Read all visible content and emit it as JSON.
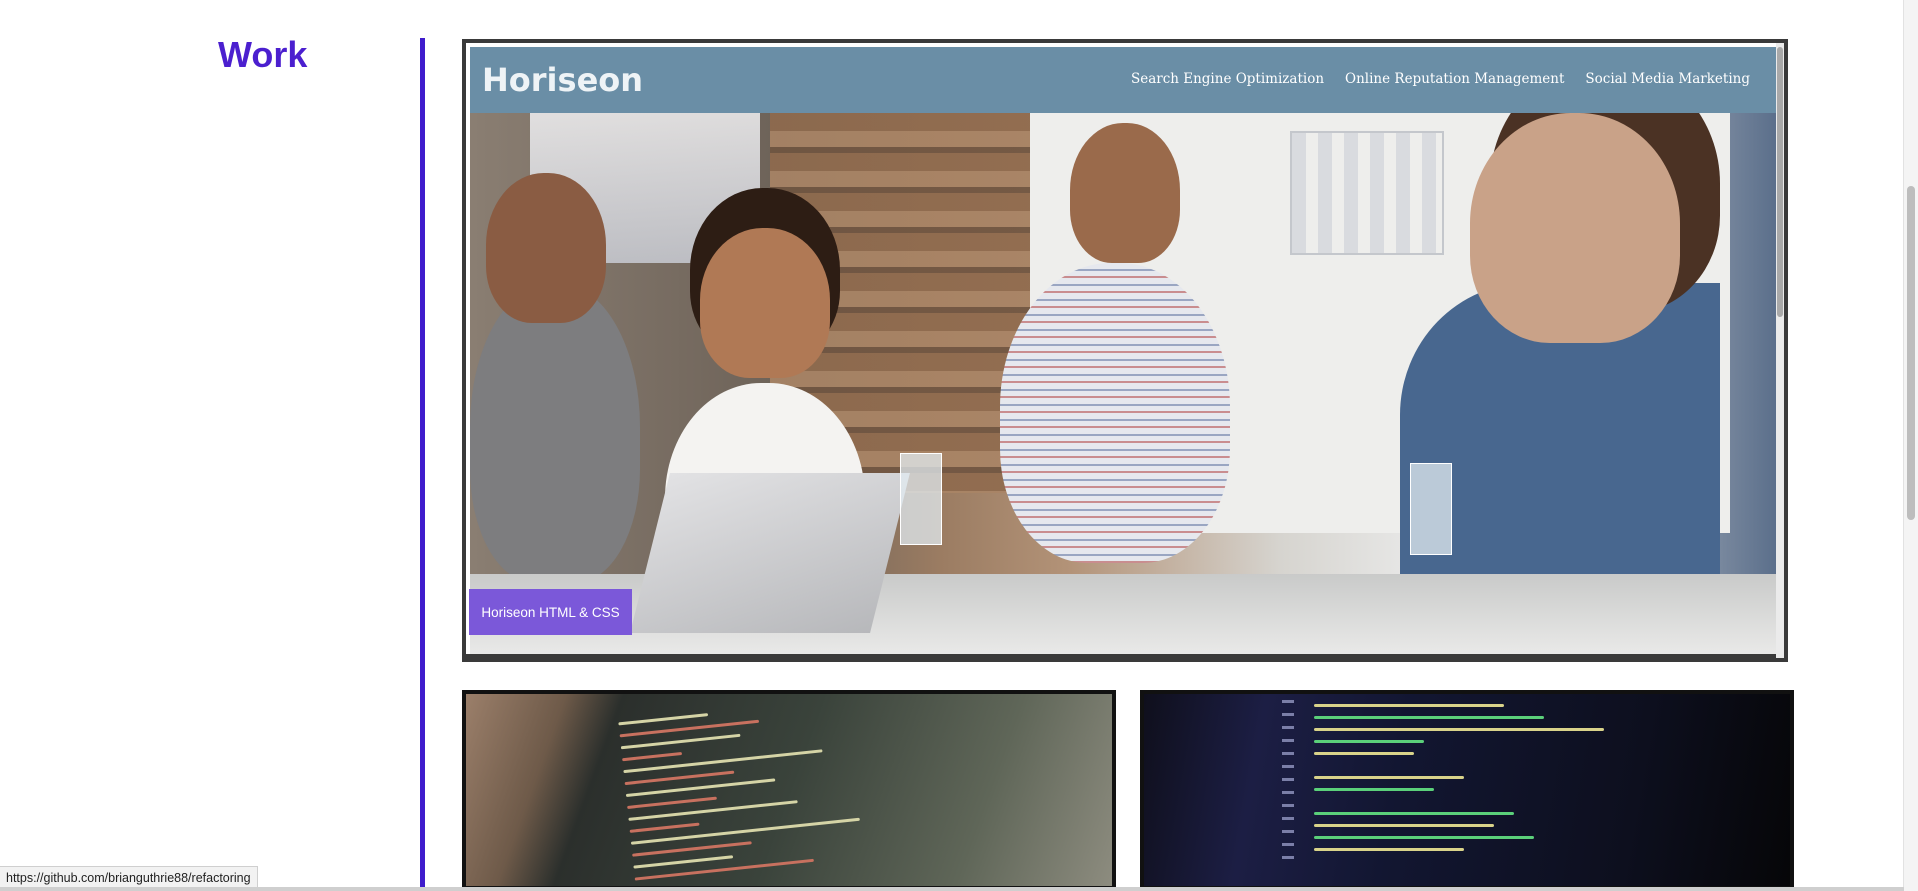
{
  "section": {
    "title": "Work"
  },
  "featured_project": {
    "preview": {
      "brand": "Horiseon",
      "nav": [
        "Search Engine Optimization",
        "Online Reputation Management",
        "Social Media Marketing"
      ]
    },
    "label": "Horiseon HTML & CSS"
  },
  "status_bar": {
    "url": "https://github.com/brianguthrie88/refactoring"
  },
  "colors": {
    "accent": "#4b1fcf",
    "project_label_bg": "#7b58d9",
    "horiseon_header": "#6a8ea6"
  }
}
